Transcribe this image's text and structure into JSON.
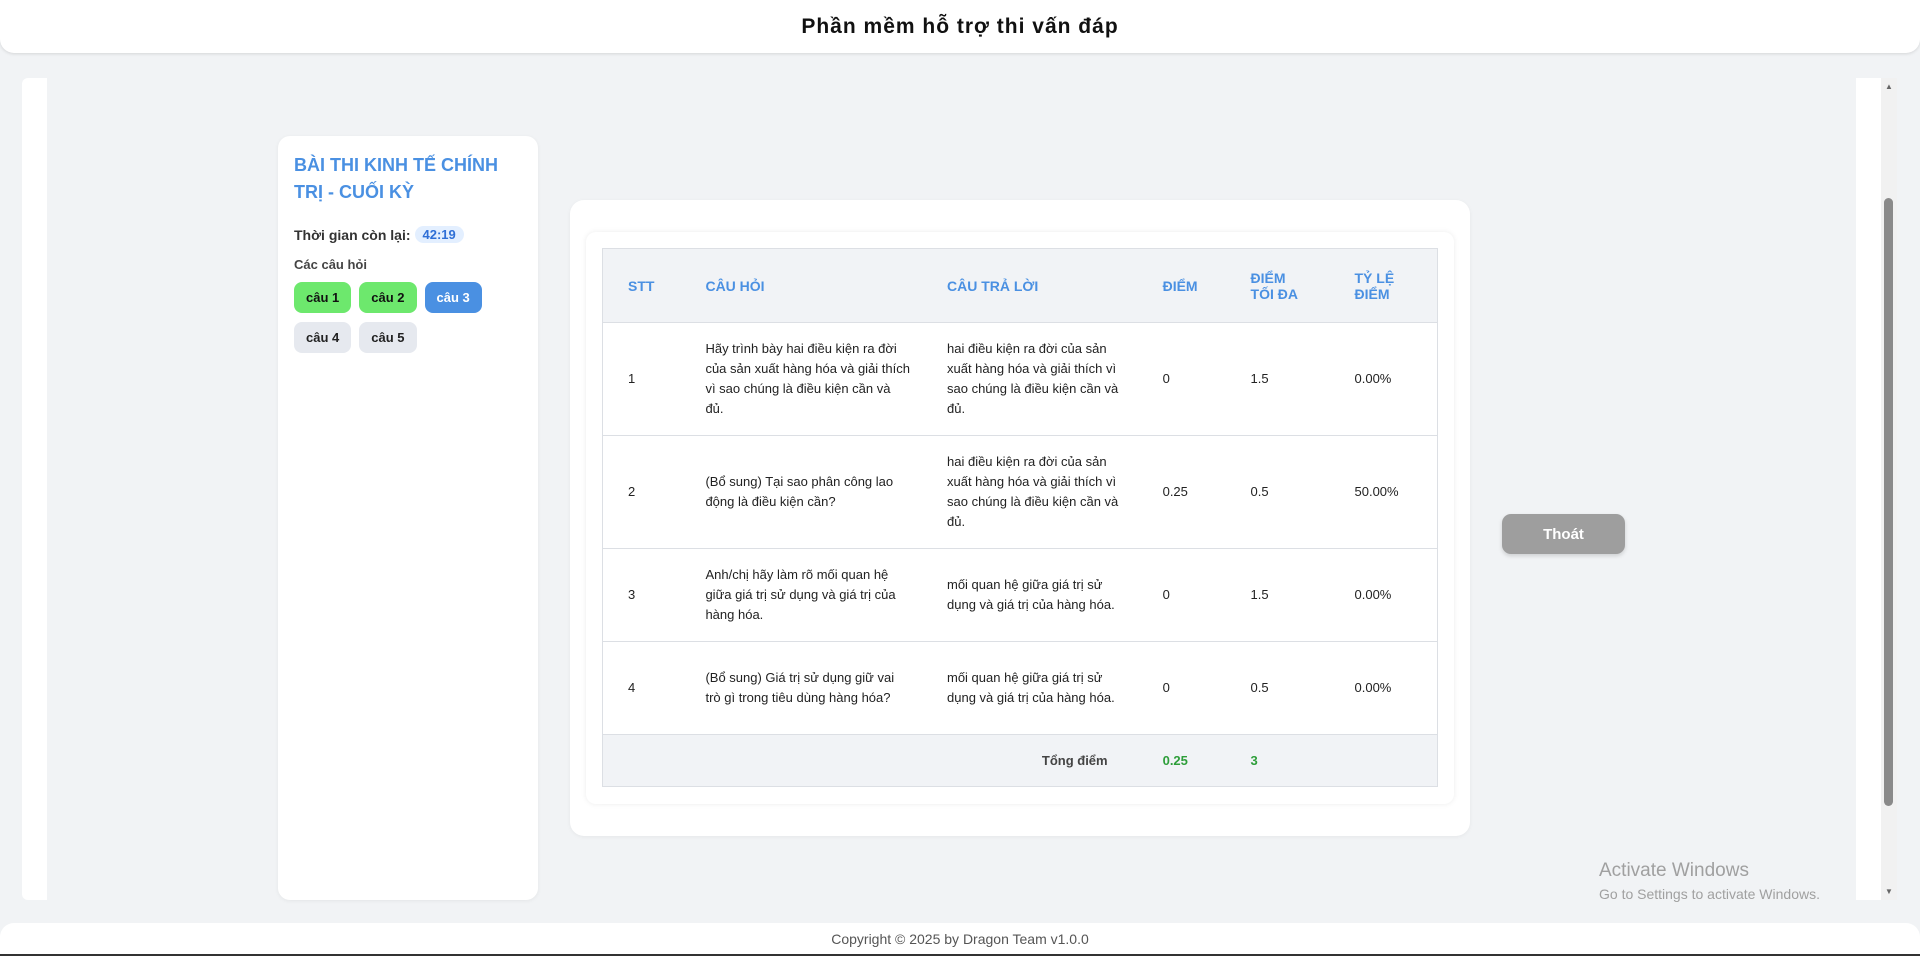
{
  "header": {
    "title": "Phần mềm hỗ trợ thi vấn đáp"
  },
  "sidebar": {
    "exam_title": "BÀI THI KINH TẾ CHÍNH TRỊ - CUỐI KỲ",
    "timer_label": "Thời gian còn lại:",
    "timer_value": "42:19",
    "questions_label": "Các câu hỏi",
    "questions": [
      {
        "label": "câu 1",
        "state": "done"
      },
      {
        "label": "câu 2",
        "state": "done"
      },
      {
        "label": "câu 3",
        "state": "active"
      },
      {
        "label": "câu 4",
        "state": "todo"
      },
      {
        "label": "câu 5",
        "state": "todo"
      }
    ]
  },
  "table": {
    "columns": {
      "stt": "STT",
      "question": "CÂU HỎI",
      "answer": "CÂU TRẢ LỜI",
      "score": "ĐIỂM",
      "max_score": "ĐIỂM TỐI ĐA",
      "ratio": "TỶ LỆ ĐIỂM"
    },
    "rows": [
      {
        "stt": "1",
        "question": "Hãy trình bày hai điều kiện ra đời của sản xuất hàng hóa và giải thích vì sao chúng là điều kiện cần và đủ.",
        "answer": "hai điều kiện ra đời của sản xuất hàng hóa và giải thích vì sao chúng là điều kiện cần và đủ.",
        "score": "0",
        "max_score": "1.5",
        "ratio": "0.00%"
      },
      {
        "stt": "2",
        "question": "(Bổ sung) Tại sao phân công lao động là điều kiện cần?",
        "answer": "hai điều kiện ra đời của sản xuất hàng hóa và giải thích vì sao chúng là điều kiện cần và đủ.",
        "score": "0.25",
        "max_score": "0.5",
        "ratio": "50.00%"
      },
      {
        "stt": "3",
        "question": "Anh/chị hãy làm rõ mối quan hệ giữa giá trị sử dụng và giá trị của hàng hóa.",
        "answer": "mối quan hệ giữa giá trị sử dụng và giá trị của hàng hóa.",
        "score": "0",
        "max_score": "1.5",
        "ratio": "0.00%"
      },
      {
        "stt": "4",
        "question": "(Bổ sung) Giá trị sử dụng giữ vai trò gì trong tiêu dùng hàng hóa?",
        "answer": "mối quan hệ giữa giá trị sử dụng và giá trị của hàng hóa.",
        "score": "0",
        "max_score": "0.5",
        "ratio": "0.00%"
      }
    ],
    "total": {
      "label": "Tổng điểm",
      "score": "0.25",
      "max_score": "3"
    }
  },
  "actions": {
    "exit_label": "Thoát"
  },
  "watermark": {
    "line1": "Activate Windows",
    "line2": "Go to Settings to activate Windows."
  },
  "footer": {
    "text": "Copyright © 2025 by Dragon Team v1.0.0"
  },
  "colors": {
    "accent": "#4a90e2",
    "done": "#6de86d",
    "total": "#2e9e3a",
    "exit": "#9e9e9e"
  }
}
